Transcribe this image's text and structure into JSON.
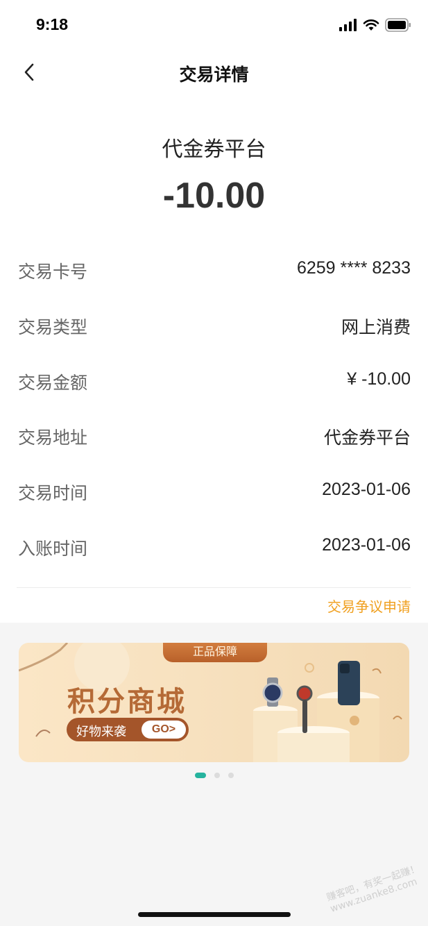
{
  "status_bar": {
    "time": "9:18"
  },
  "nav": {
    "title": "交易详情",
    "back_icon": "chevron-left-icon"
  },
  "header": {
    "merchant": "代金券平台",
    "amount": "-10.00"
  },
  "details": [
    {
      "label": "交易卡号",
      "value": "6259 **** 8233"
    },
    {
      "label": "交易类型",
      "value": "网上消费"
    },
    {
      "label": "交易金额",
      "value": "¥ -10.00"
    },
    {
      "label": "交易地址",
      "value": "代金券平台"
    },
    {
      "label": "交易时间",
      "value": "2023-01-06"
    },
    {
      "label": "入账时间",
      "value": "2023-01-06"
    }
  ],
  "dispute_link": "交易争议申请",
  "banner": {
    "tag": "正品保障",
    "title": "积分商城",
    "subtitle": "好物来袭",
    "cta": "GO>"
  },
  "carousel": {
    "page_count": 3,
    "active_index": 0
  },
  "watermark": "赚客吧，有奖一起赚！ www.zuanke8.com",
  "colors": {
    "accent": "#26b39e",
    "link": "#f0a020",
    "banner_brown": "#a4552a"
  }
}
